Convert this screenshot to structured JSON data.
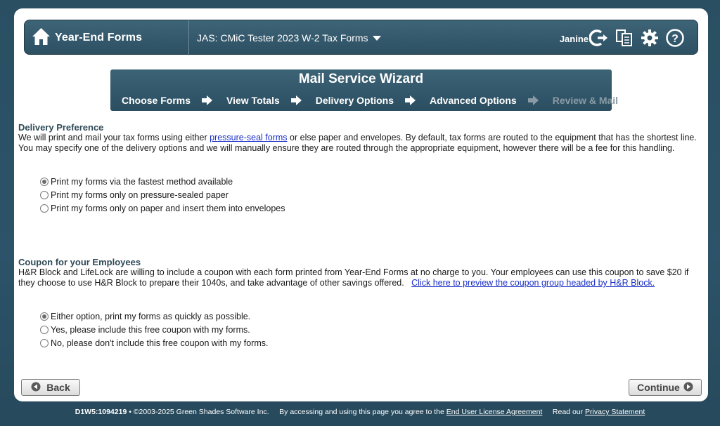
{
  "header": {
    "app_title": "Year-End Forms",
    "company": "JAS: CMiC Tester 2023 W-2 Tax Forms",
    "user_name": "Janine"
  },
  "wizard": {
    "title": "Mail Service Wizard",
    "steps": [
      {
        "label": "Choose Forms",
        "active": true
      },
      {
        "label": "View Totals",
        "active": true
      },
      {
        "label": "Delivery Options",
        "active": true
      },
      {
        "label": "Advanced Options",
        "active": true
      },
      {
        "label": "Review & Mail",
        "active": false
      }
    ]
  },
  "delivery": {
    "title": "Delivery Preference",
    "text_before": "We will print and mail your tax forms using either ",
    "link": "pressure-seal forms",
    "text_after": " or else paper and envelopes. By default, tax forms are routed to the equipment that has the shortest line. You may specify one of the delivery options and we will manually ensure they are routed through the appropriate equipment, however there will be a fee for this handling.",
    "options": [
      {
        "label": "Print my forms via the fastest method available",
        "checked": true
      },
      {
        "label": "Print my forms only on pressure-sealed paper",
        "checked": false
      },
      {
        "label": "Print my forms only on paper and insert them into envelopes",
        "checked": false
      }
    ]
  },
  "coupon": {
    "title": "Coupon for your Employees",
    "text": "H&R Block and LifeLock are willing to include a coupon with each form printed from Year-End Forms at no charge to you. Your employees can use this coupon to save $20 if they choose to use H&R Block to prepare their 1040s, and take advantage of other savings offered.",
    "link": "Click here to preview the coupon group headed by H&R Block.",
    "options": [
      {
        "label": "Either option, print my forms as quickly as possible.",
        "checked": true
      },
      {
        "label": "Yes, please include this free coupon with my forms.",
        "checked": false
      },
      {
        "label": "No, please don't include this free coupon with my forms.",
        "checked": false
      }
    ]
  },
  "buttons": {
    "back": "Back",
    "continue": "Continue"
  },
  "footer": {
    "build_id": "D1W5:1094219",
    "copyright": "• ©2003-2025 Green Shades Software Inc.",
    "agree_text": "By accessing and using this page you agree to the",
    "eula_link": "End User License Agreement",
    "read_text": "Read our",
    "privacy_link": "Privacy Statement"
  }
}
